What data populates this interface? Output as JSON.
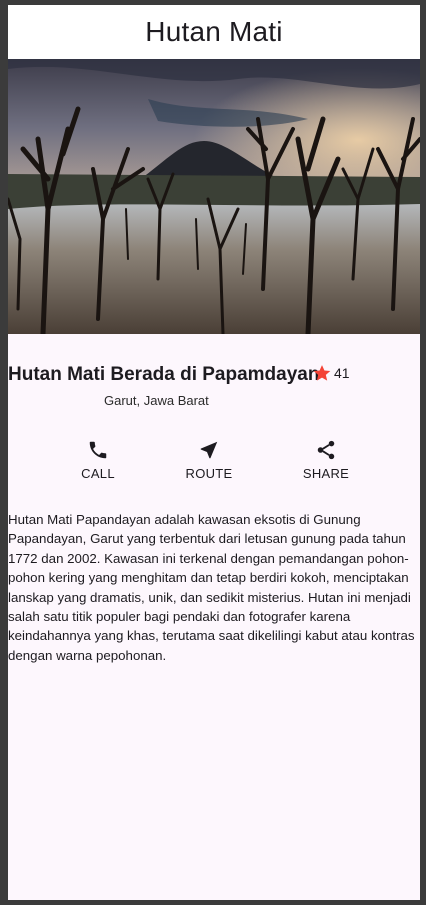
{
  "appbar": {
    "title": "Hutan Mati"
  },
  "hero": {
    "alt": "Dead forest with mountain under cloudy sunset sky"
  },
  "place": {
    "title": "Hutan Mati Berada di Papamdayan",
    "location": "Garut, Jawa Barat",
    "rating": "41",
    "star_color": "#f44336"
  },
  "actions": [
    {
      "label": "CALL",
      "icon": "phone-icon"
    },
    {
      "label": "ROUTE",
      "icon": "navigation-icon"
    },
    {
      "label": "SHARE",
      "icon": "share-icon"
    }
  ],
  "description": "Hutan Mati Papandayan adalah kawasan eksotis di Gunung Papandayan, Garut yang terbentuk dari letusan gunung pada tahun 1772 dan 2002. Kawasan ini terkenal dengan pemandangan pohon-pohon kering yang menghitam dan tetap berdiri kokoh, menciptakan lanskap yang dramatis, unik, dan sedikit misterius. Hutan ini menjadi salah satu titik populer bagi pendaki dan fotografer karena keindahannya yang khas, terutama saat dikelilingi kabut atau kontras dengan warna pepohonan."
}
